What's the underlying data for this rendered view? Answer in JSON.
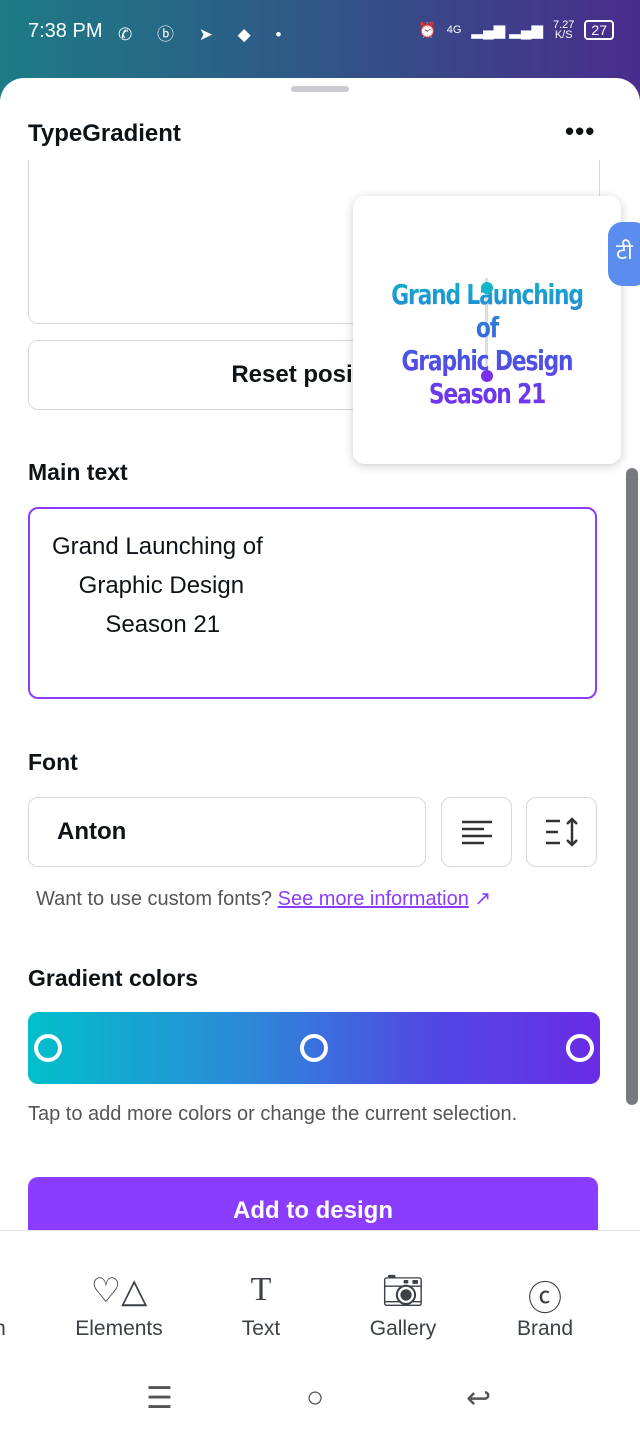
{
  "status_bar": {
    "time": "7:38 PM",
    "network": "4G",
    "speed": "7.27",
    "speed_unit": "K/S",
    "battery": "27"
  },
  "header": {
    "title": "TypeGradient",
    "more_label": "•••"
  },
  "reset_button": "Reset position",
  "preview": {
    "lines": [
      "Grand Launching of",
      "Graphic Design",
      "Season 21"
    ]
  },
  "translate_glyph": "टी",
  "main_text": {
    "label": "Main text",
    "value": "Grand Launching of\n    Graphic Design\n        Season 21"
  },
  "font": {
    "label": "Font",
    "value": "Anton",
    "help": "Want to use custom fonts?",
    "link": "See more information"
  },
  "gradient": {
    "label": "Gradient colors",
    "colors": [
      "#02bfcb",
      "#5049e3",
      "#6a2ce6"
    ],
    "help": "Tap to add more colors or change the current selection."
  },
  "add_button": "Add to design",
  "bottom_nav": [
    {
      "label": "n"
    },
    {
      "label": "Elements"
    },
    {
      "label": "Text"
    },
    {
      "label": "Gallery"
    },
    {
      "label": "Brand"
    }
  ],
  "accent": "#8b3dff"
}
